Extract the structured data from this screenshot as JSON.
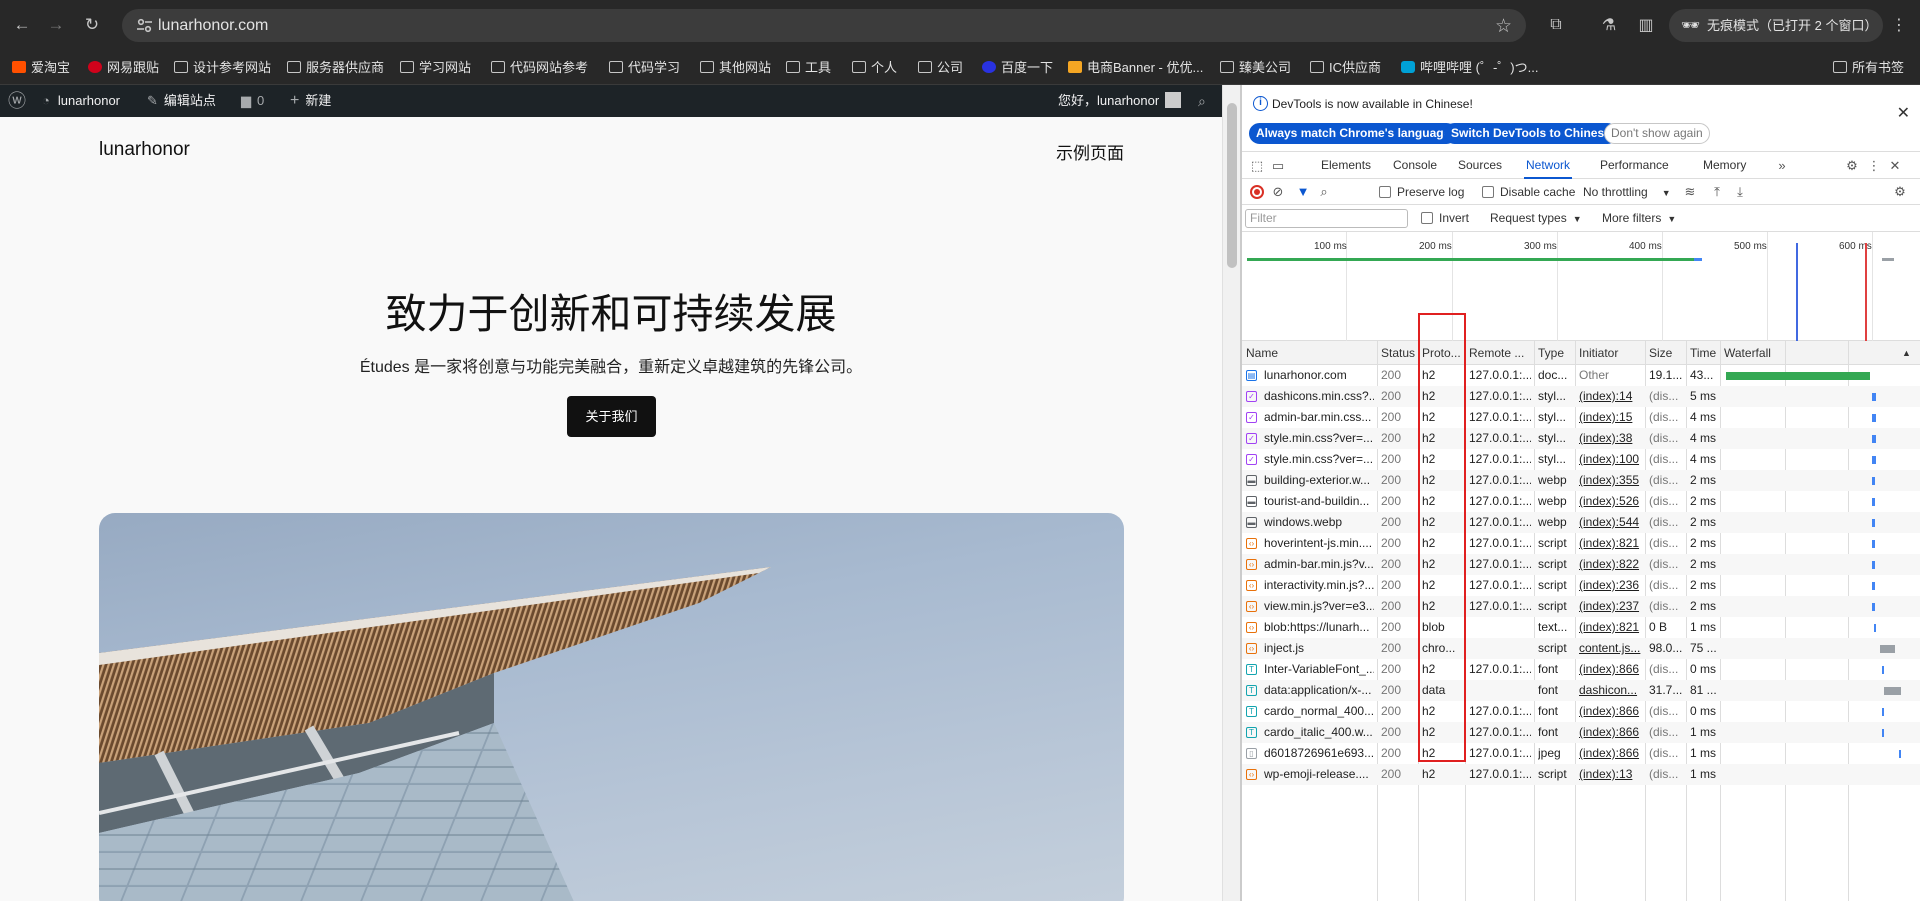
{
  "browser": {
    "url": "lunarhonor.com",
    "incognito_label": "无痕模式（已打开 2 个窗口）"
  },
  "bookmarks": [
    {
      "label": "爱淘宝",
      "icon": "taobao-icon"
    },
    {
      "label": "网易跟贴",
      "icon": "netease-icon"
    },
    {
      "label": "设计参考网站",
      "icon": "folder-icon"
    },
    {
      "label": "服务器供应商",
      "icon": "folder-icon"
    },
    {
      "label": "学习网站",
      "icon": "folder-icon"
    },
    {
      "label": "代码网站参考",
      "icon": "folder-icon"
    },
    {
      "label": "代码学习",
      "icon": "folder-icon"
    },
    {
      "label": "其他网站",
      "icon": "folder-icon"
    },
    {
      "label": "工具",
      "icon": "folder-icon"
    },
    {
      "label": "个人",
      "icon": "folder-icon"
    },
    {
      "label": "公司",
      "icon": "folder-icon"
    },
    {
      "label": "百度一下",
      "icon": "baidu-icon"
    },
    {
      "label": "电商Banner - 优优...",
      "icon": "banner-icon"
    },
    {
      "label": "臻美公司",
      "icon": "folder-icon"
    },
    {
      "label": "IC供应商",
      "icon": "folder-icon"
    },
    {
      "label": "哔哩哔哩 (゜-゜)つ...",
      "icon": "bilibili-icon"
    }
  ],
  "all_bookmarks_label": "所有书签",
  "wpbar": {
    "site": "lunarhonor",
    "edit": "编辑站点",
    "comments": "0",
    "new": "新建",
    "greeting": "您好，lunarhonor"
  },
  "page": {
    "site_title": "lunarhonor",
    "nav_item": "示例页面",
    "hero_title": "致力于创新和可持续发展",
    "hero_text": "Études 是一家将创意与功能完美融合，重新定义卓越建筑的先锋公司。",
    "hero_button": "关于我们"
  },
  "devtools": {
    "info_message": "DevTools is now available in Chinese!",
    "btn_match": "Always match Chrome's language",
    "btn_switch": "Switch DevTools to Chinese",
    "btn_dismiss": "Don't show again",
    "tabs": [
      "Elements",
      "Console",
      "Sources",
      "Network",
      "Performance",
      "Memory"
    ],
    "active_tab": "Network",
    "preserve_log": "Preserve log",
    "disable_cache": "Disable cache",
    "throttling": "No throttling",
    "filter_placeholder": "Filter",
    "invert": "Invert",
    "request_types": "Request types",
    "more_filters": "More filters",
    "overview_ticks": [
      "100 ms",
      "200 ms",
      "300 ms",
      "400 ms",
      "500 ms",
      "600 ms"
    ],
    "columns": [
      "Name",
      "Status",
      "Proto...",
      "Remote ...",
      "Type",
      "Initiator",
      "Size",
      "Time",
      "Waterfall"
    ],
    "rows": [
      {
        "name": "lunarhonor.com",
        "status": "200",
        "proto": "h2",
        "remote": "127.0.0.1:...",
        "type": "doc...",
        "initiator": "Other",
        "size": "19.1...",
        "time": "43...",
        "kind": "doc",
        "wf_start": 0.01,
        "wf_len": 0.76,
        "wf_color": "#34a853"
      },
      {
        "name": "dashicons.min.css?...",
        "status": "200",
        "proto": "h2",
        "remote": "127.0.0.1:...",
        "type": "styl...",
        "initiator": "(index):14",
        "size": "(dis...",
        "time": "5 ms",
        "kind": "css",
        "wf_start": 0.78,
        "wf_len": 0.02,
        "wf_color": "#4285f4"
      },
      {
        "name": "admin-bar.min.css...",
        "status": "200",
        "proto": "h2",
        "remote": "127.0.0.1:...",
        "type": "styl...",
        "initiator": "(index):15",
        "size": "(dis...",
        "time": "4 ms",
        "kind": "css",
        "wf_start": 0.78,
        "wf_len": 0.02,
        "wf_color": "#4285f4"
      },
      {
        "name": "style.min.css?ver=...",
        "status": "200",
        "proto": "h2",
        "remote": "127.0.0.1:...",
        "type": "styl...",
        "initiator": "(index):38",
        "size": "(dis...",
        "time": "4 ms",
        "kind": "css",
        "wf_start": 0.78,
        "wf_len": 0.02,
        "wf_color": "#4285f4"
      },
      {
        "name": "style.min.css?ver=...",
        "status": "200",
        "proto": "h2",
        "remote": "127.0.0.1:...",
        "type": "styl...",
        "initiator": "(index):100",
        "size": "(dis...",
        "time": "4 ms",
        "kind": "css",
        "wf_start": 0.78,
        "wf_len": 0.02,
        "wf_color": "#4285f4"
      },
      {
        "name": "building-exterior.w...",
        "status": "200",
        "proto": "h2",
        "remote": "127.0.0.1:...",
        "type": "webp",
        "initiator": "(index):355",
        "size": "(dis...",
        "time": "2 ms",
        "kind": "img",
        "wf_start": 0.78,
        "wf_len": 0.015,
        "wf_color": "#4285f4"
      },
      {
        "name": "tourist-and-buildin...",
        "status": "200",
        "proto": "h2",
        "remote": "127.0.0.1:...",
        "type": "webp",
        "initiator": "(index):526",
        "size": "(dis...",
        "time": "2 ms",
        "kind": "img",
        "wf_start": 0.78,
        "wf_len": 0.015,
        "wf_color": "#4285f4"
      },
      {
        "name": "windows.webp",
        "status": "200",
        "proto": "h2",
        "remote": "127.0.0.1:...",
        "type": "webp",
        "initiator": "(index):544",
        "size": "(dis...",
        "time": "2 ms",
        "kind": "img",
        "wf_start": 0.78,
        "wf_len": 0.015,
        "wf_color": "#4285f4"
      },
      {
        "name": "hoverintent-js.min....",
        "status": "200",
        "proto": "h2",
        "remote": "127.0.0.1:...",
        "type": "script",
        "initiator": "(index):821",
        "size": "(dis...",
        "time": "2 ms",
        "kind": "js",
        "wf_start": 0.78,
        "wf_len": 0.015,
        "wf_color": "#4285f4"
      },
      {
        "name": "admin-bar.min.js?v...",
        "status": "200",
        "proto": "h2",
        "remote": "127.0.0.1:...",
        "type": "script",
        "initiator": "(index):822",
        "size": "(dis...",
        "time": "2 ms",
        "kind": "js",
        "wf_start": 0.78,
        "wf_len": 0.015,
        "wf_color": "#4285f4"
      },
      {
        "name": "interactivity.min.js?...",
        "status": "200",
        "proto": "h2",
        "remote": "127.0.0.1:...",
        "type": "script",
        "initiator": "(index):236",
        "size": "(dis...",
        "time": "2 ms",
        "kind": "js",
        "wf_start": 0.78,
        "wf_len": 0.015,
        "wf_color": "#4285f4"
      },
      {
        "name": "view.min.js?ver=e3...",
        "status": "200",
        "proto": "h2",
        "remote": "127.0.0.1:...",
        "type": "script",
        "initiator": "(index):237",
        "size": "(dis...",
        "time": "2 ms",
        "kind": "js",
        "wf_start": 0.78,
        "wf_len": 0.015,
        "wf_color": "#4285f4"
      },
      {
        "name": "blob:https://lunarh...",
        "status": "200",
        "proto": "blob",
        "remote": "",
        "type": "text...",
        "initiator": "(index):821",
        "size": "0 B",
        "time": "1 ms",
        "kind": "js",
        "wf_start": 0.79,
        "wf_len": 0.01,
        "wf_color": "#4285f4"
      },
      {
        "name": "inject.js",
        "status": "200",
        "proto": "chro...",
        "remote": "",
        "type": "script",
        "initiator": "content.js...",
        "size": "98.0...",
        "time": "75 ...",
        "kind": "js",
        "wf_start": 0.82,
        "wf_len": 0.08,
        "wf_color": "#9aa0a6"
      },
      {
        "name": "Inter-VariableFont_...",
        "status": "200",
        "proto": "h2",
        "remote": "127.0.0.1:...",
        "type": "font",
        "initiator": "(index):866",
        "size": "(dis...",
        "time": "0 ms",
        "kind": "font",
        "wf_start": 0.83,
        "wf_len": 0.008,
        "wf_color": "#4285f4"
      },
      {
        "name": "data:application/x-...",
        "status": "200",
        "proto": "data",
        "remote": "",
        "type": "font",
        "initiator": "dashicon...",
        "size": "31.7...",
        "time": "81 ...",
        "kind": "font",
        "wf_start": 0.84,
        "wf_len": 0.09,
        "wf_color": "#9aa0a6"
      },
      {
        "name": "cardo_normal_400....",
        "status": "200",
        "proto": "h2",
        "remote": "127.0.0.1:...",
        "type": "font",
        "initiator": "(index):866",
        "size": "(dis...",
        "time": "0 ms",
        "kind": "font",
        "wf_start": 0.83,
        "wf_len": 0.008,
        "wf_color": "#4285f4"
      },
      {
        "name": "cardo_italic_400.w...",
        "status": "200",
        "proto": "h2",
        "remote": "127.0.0.1:...",
        "type": "font",
        "initiator": "(index):866",
        "size": "(dis...",
        "time": "1 ms",
        "kind": "font",
        "wf_start": 0.83,
        "wf_len": 0.008,
        "wf_color": "#4285f4"
      },
      {
        "name": "d6018726961e693...",
        "status": "200",
        "proto": "h2",
        "remote": "127.0.0.1:...",
        "type": "jpeg",
        "initiator": "(index):866",
        "size": "(dis...",
        "time": "1 ms",
        "kind": "jpeg",
        "wf_start": 0.92,
        "wf_len": 0.008,
        "wf_color": "#4285f4"
      },
      {
        "name": "wp-emoji-release....",
        "status": "200",
        "proto": "h2",
        "remote": "127.0.0.1:...",
        "type": "script",
        "initiator": "(index):13",
        "size": "(dis...",
        "time": "1 ms",
        "kind": "js",
        "wf_start": 0.0,
        "wf_len": 0.0,
        "wf_color": "#4285f4"
      }
    ]
  }
}
